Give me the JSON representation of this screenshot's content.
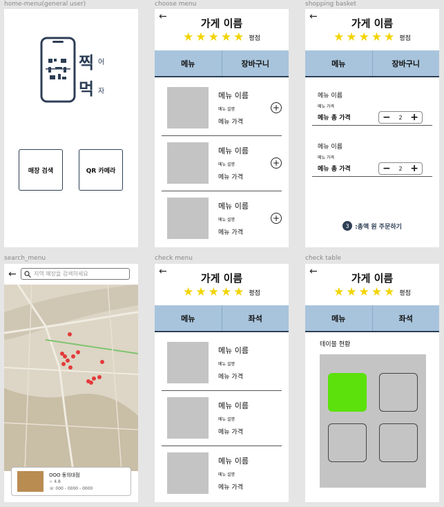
{
  "frames": {
    "home": {
      "label": "home-menu(general user)",
      "logo_text": [
        "찍",
        "어",
        "먹",
        "자"
      ],
      "buttons": [
        "매장 검색",
        "QR 카메라"
      ]
    },
    "search": {
      "label": "search_menu",
      "search_placeholder": "지역 매장을 검색하세요",
      "result": {
        "name": "OOO 동의대점",
        "rating": "☆ 4.8",
        "phone": "☏ 000 - 0000 - 0000"
      }
    },
    "choose_menu": {
      "label": "choose menu",
      "store_name": "가게 이름",
      "rating_label": "평점",
      "tabs": [
        "메뉴",
        "장바구니"
      ],
      "items": [
        {
          "name": "메뉴 이름",
          "desc": "메뉴 설명",
          "price": "메뉴 가격"
        },
        {
          "name": "메뉴 이름",
          "desc": "메뉴 설명",
          "price": "메뉴 가격"
        },
        {
          "name": "메뉴 이름",
          "desc": "메뉴 설명",
          "price": "메뉴 가격"
        }
      ]
    },
    "basket": {
      "label": "shopping basket",
      "store_name": "가게 이름",
      "rating_label": "평점",
      "tabs": [
        "메뉴",
        "장바구니"
      ],
      "items": [
        {
          "name": "메뉴 이름",
          "desc": "메뉴 가격",
          "total": "메뉴 총 가격",
          "qty": "2"
        },
        {
          "name": "메뉴 이름",
          "desc": "메뉴 가격",
          "total": "메뉴 총 가격",
          "qty": "2"
        }
      ],
      "order_count": "3",
      "order_text": ":총액 원 주문하기"
    },
    "check_menu": {
      "label": "check menu",
      "store_name": "가게 이름",
      "rating_label": "평점",
      "tabs": [
        "메뉴",
        "좌석"
      ],
      "items": [
        {
          "name": "메뉴 이름",
          "desc": "메뉴 설명",
          "price": "메뉴 가격"
        },
        {
          "name": "메뉴 이름",
          "desc": "메뉴 설명",
          "price": "메뉴 가격"
        },
        {
          "name": "메뉴 이름",
          "desc": "메뉴 설명",
          "price": "메뉴 가격"
        }
      ]
    },
    "check_table": {
      "label": "check table",
      "store_name": "가게 이름",
      "rating_label": "평점",
      "tabs": [
        "메뉴",
        "좌석"
      ],
      "status_label": "테이블 현황",
      "tables": [
        {
          "occupied": true
        },
        {
          "occupied": false
        },
        {
          "occupied": false
        },
        {
          "occupied": false
        }
      ]
    }
  },
  "colors": {
    "accent": "#2d3e55",
    "tab_bg": "#a8c4dc",
    "star": "#f2d400",
    "occupied": "#5ce10c",
    "placeholder": "#c4c4c4"
  },
  "icons": [
    "back-arrow-icon",
    "star-icon",
    "add-circle-icon",
    "minus-icon",
    "plus-icon",
    "search-icon",
    "map-pin-icon",
    "phone-logo-icon"
  ]
}
